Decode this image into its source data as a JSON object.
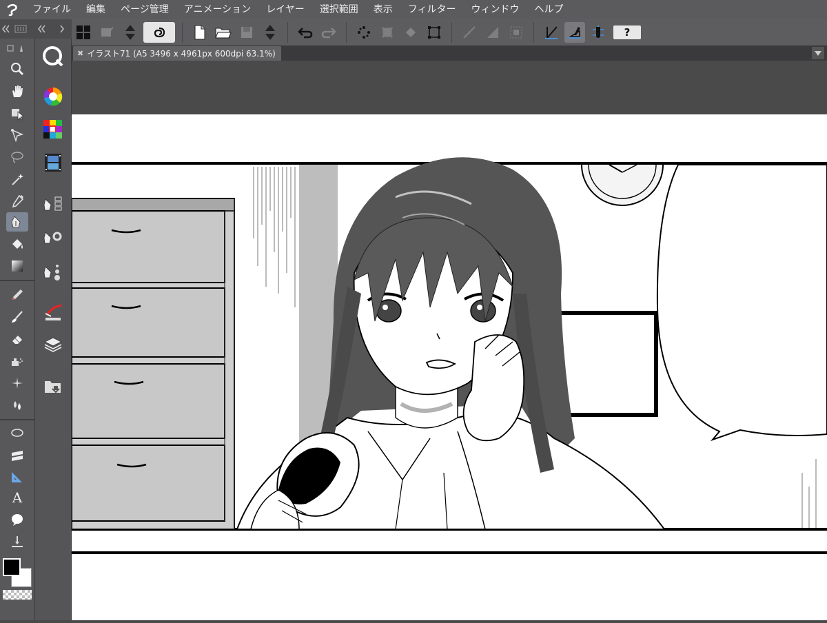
{
  "menu": {
    "items": [
      "ファイル",
      "編集",
      "ページ管理",
      "アニメーション",
      "レイヤー",
      "選択範囲",
      "表示",
      "フィルター",
      "ウィンドウ",
      "ヘルプ"
    ]
  },
  "document": {
    "tab_title": "イラスト71 (A5 3496 x 4961px 600dpi 63.1%)"
  },
  "toolbar": {
    "help_label": "?"
  },
  "tools": {
    "text_glyph": "A"
  },
  "colors": {
    "main": "#000000",
    "sub": "#ffffff",
    "active_tool_bg": "#7d8796",
    "accent_blue": "#4a8fd8"
  }
}
